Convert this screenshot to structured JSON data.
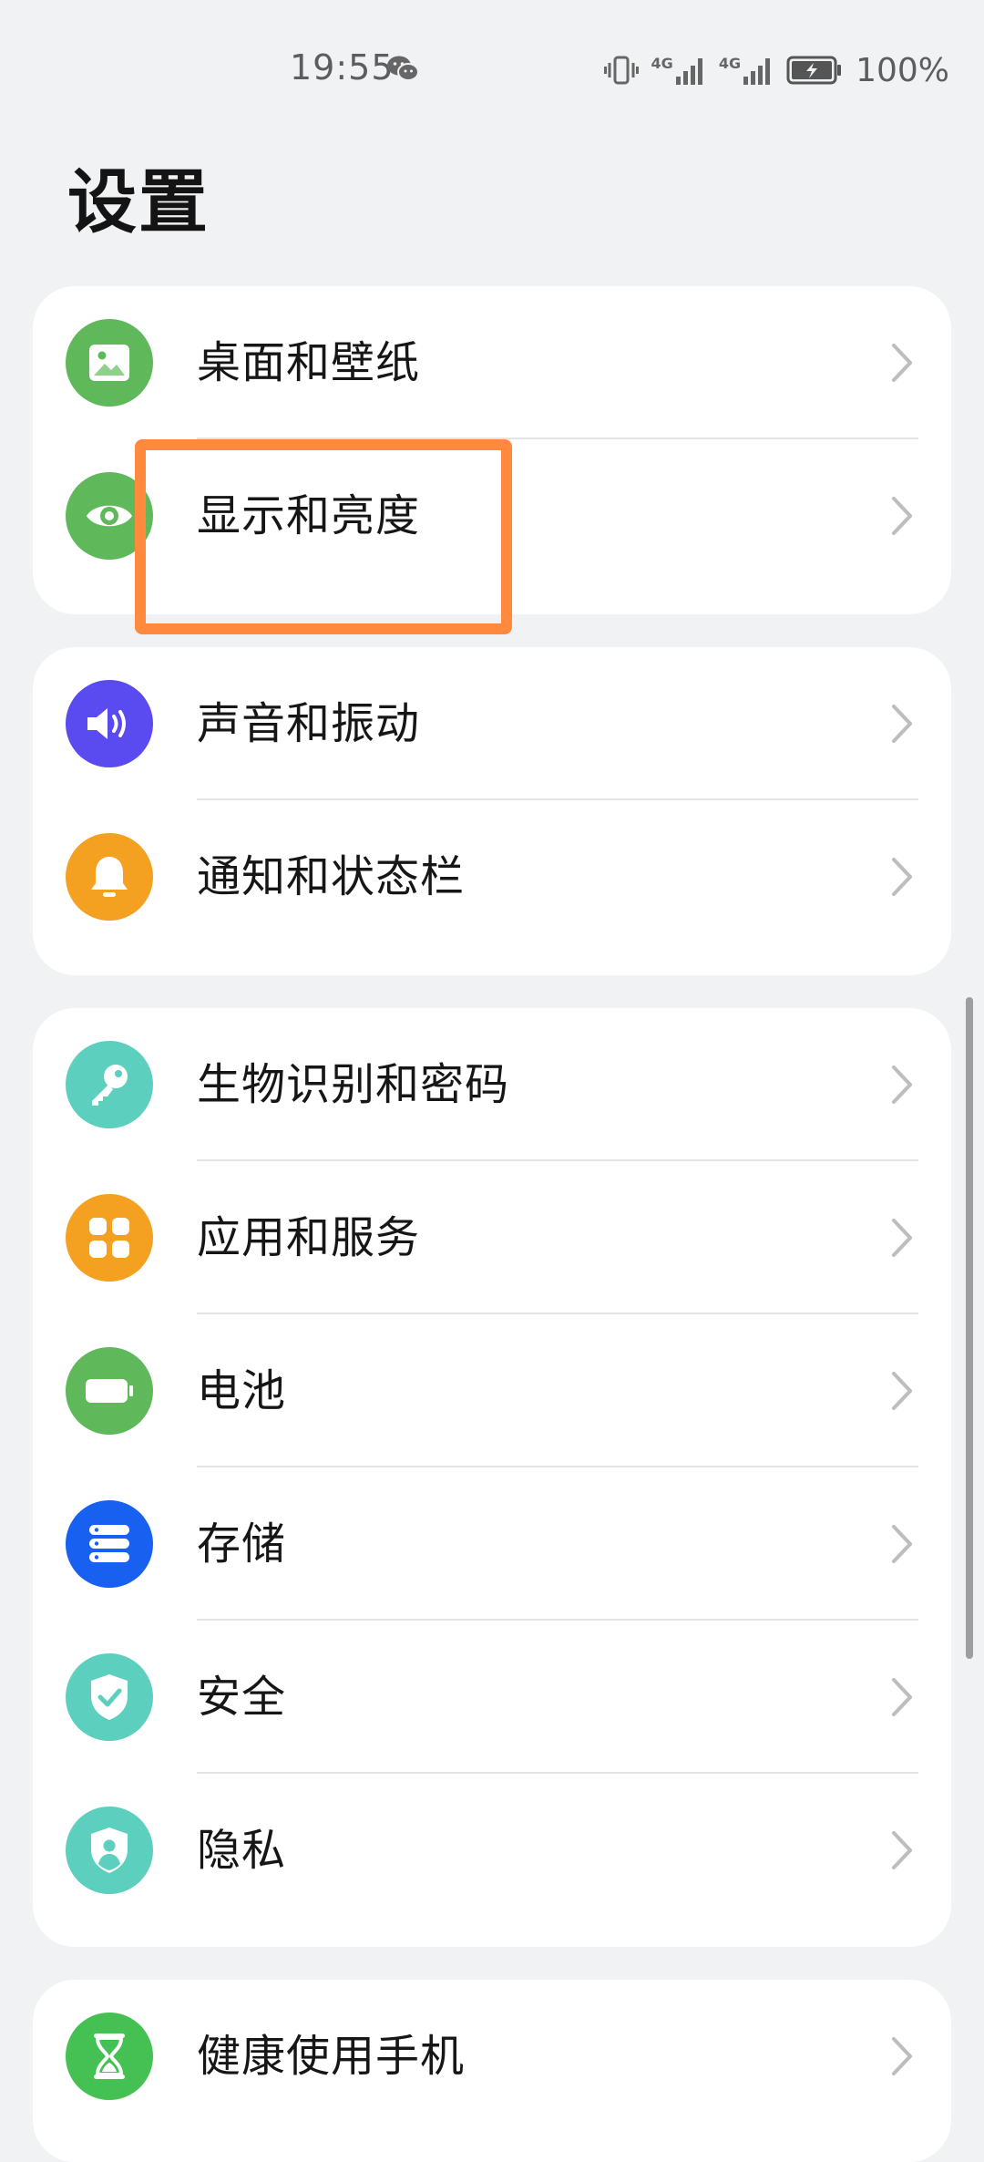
{
  "status_bar": {
    "time": "19:55",
    "battery": "100%",
    "network_1": "4G",
    "network_2": "4G"
  },
  "page": {
    "title": "设置"
  },
  "groups": [
    {
      "items": [
        {
          "label": "桌面和壁纸",
          "icon": "wallpaper-icon",
          "color": "#5fb95a"
        },
        {
          "label": "显示和亮度",
          "icon": "eye-icon",
          "color": "#5fb95a"
        }
      ]
    },
    {
      "items": [
        {
          "label": "声音和振动",
          "icon": "speaker-icon",
          "color": "#5a4bf0"
        },
        {
          "label": "通知和状态栏",
          "icon": "bell-icon",
          "color": "#f4a020"
        }
      ]
    },
    {
      "items": [
        {
          "label": "生物识别和密码",
          "icon": "key-icon",
          "color": "#5dcfbf"
        },
        {
          "label": "应用和服务",
          "icon": "apps-grid-icon",
          "color": "#f4a020"
        },
        {
          "label": "电池",
          "icon": "battery-icon",
          "color": "#5fb95a"
        },
        {
          "label": "存储",
          "icon": "storage-icon",
          "color": "#1760f0"
        },
        {
          "label": "安全",
          "icon": "shield-check-icon",
          "color": "#5dcfbf"
        },
        {
          "label": "隐私",
          "icon": "privacy-shield-icon",
          "color": "#5dcfbf"
        }
      ]
    },
    {
      "items": [
        {
          "label": "健康使用手机",
          "icon": "hourglass-icon",
          "color": "#44c152"
        }
      ]
    }
  ],
  "colors": {
    "background": "#f1f2f4",
    "card": "#ffffff",
    "highlight": "#ff8a3d"
  }
}
